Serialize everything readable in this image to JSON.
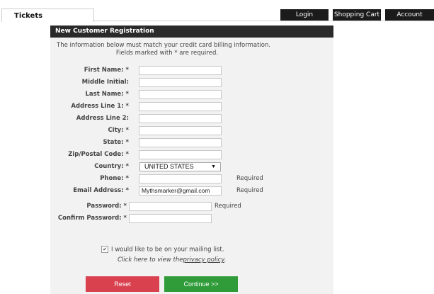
{
  "header": {
    "tab_label": "Tickets",
    "nav": [
      "Login",
      "Shopping Cart",
      "Account"
    ]
  },
  "panel": {
    "title": "New Customer Registration",
    "intro_line1": "The information below must match your credit card billing information.",
    "intro_line2": "Fields marked with * are required."
  },
  "form": {
    "fields": [
      {
        "label": "First Name: *",
        "value": "",
        "note": ""
      },
      {
        "label": "Middle Initial:",
        "value": "",
        "note": ""
      },
      {
        "label": "Last Name: *",
        "value": "",
        "note": ""
      },
      {
        "label": "Address Line 1: *",
        "value": "",
        "note": ""
      },
      {
        "label": "Address Line 2:",
        "value": "",
        "note": ""
      },
      {
        "label": "City: *",
        "value": "",
        "note": ""
      },
      {
        "label": "State: *",
        "value": "",
        "note": ""
      },
      {
        "label": "Zip/Postal Code: *",
        "value": "",
        "note": ""
      }
    ],
    "country": {
      "label": "Country: *",
      "selected": "UNITED STATES"
    },
    "phone": {
      "label": "Phone: *",
      "value": "",
      "note": "Required"
    },
    "email": {
      "label": "Email Address: *",
      "value": "Mythsmarker@gmail.com",
      "note": "Required"
    },
    "password": {
      "label": "Password: *",
      "value": "",
      "note": "Required"
    },
    "confirm_password": {
      "label": "Confirm Password: *",
      "value": ""
    }
  },
  "mailing": {
    "checked": true,
    "label": "I would like to be on your mailing list.",
    "privacy_prefix": "Click here to view the",
    "privacy_link": "privacy policy",
    "privacy_suffix": "."
  },
  "buttons": {
    "reset": "Reset",
    "continue": "Continue >>"
  },
  "colors": {
    "reset_bg": "#d9414f",
    "continue_bg": "#2f9c39",
    "header_bg": "#2a2a2a"
  }
}
